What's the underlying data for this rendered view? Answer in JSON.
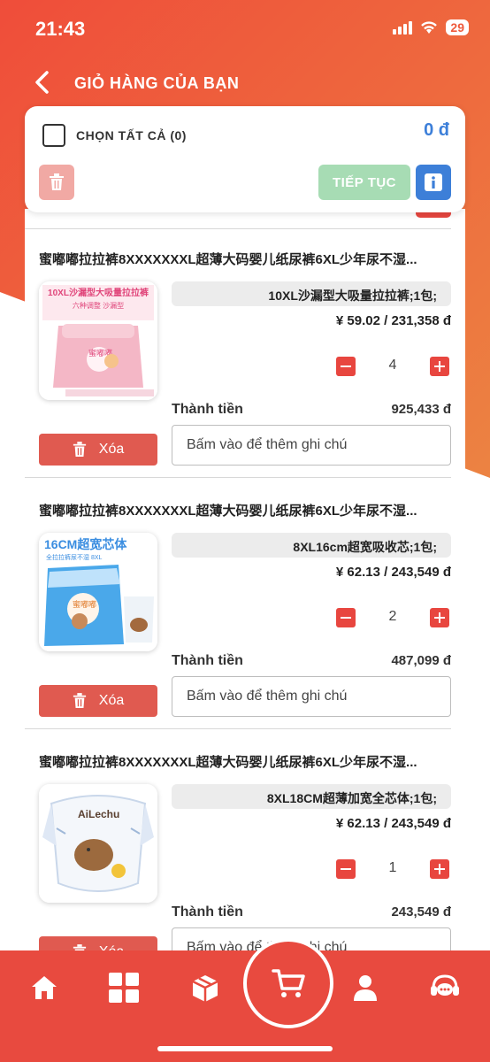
{
  "status_bar": {
    "time": "21:43",
    "battery": "29"
  },
  "header": {
    "title": "GIỎ HÀNG CỦA BẠN"
  },
  "top_card": {
    "select_all_label": "CHỌN TẤT CẢ (0)",
    "total": "0 đ",
    "continue_label": "TIẾP TỤC"
  },
  "items": [
    {
      "title": "蜜嘟嘟拉拉裤8XXXXXXXL超薄大码婴儿纸尿裤6XL少年尿不湿...",
      "variant": "10XL沙漏型大吸量拉拉裤;1包;",
      "price": "¥ 59.02 / 231,358 đ",
      "quantity": "4",
      "subtotal_label": "Thành tiền",
      "subtotal": "925,433 đ",
      "delete_label": "Xóa",
      "note_placeholder": "Bấm vào để thêm ghi chú",
      "thumb_banner": "10XL沙漏型大吸量拉拉裤",
      "thumb_brand": "蜜嘟嘟"
    },
    {
      "title": "蜜嘟嘟拉拉裤8XXXXXXXL超薄大码婴儿纸尿裤6XL少年尿不湿...",
      "variant": "8XL16cm超宽吸收芯;1包;",
      "price": "¥ 62.13 / 243,549 đ",
      "quantity": "2",
      "subtotal_label": "Thành tiền",
      "subtotal": "487,099 đ",
      "delete_label": "Xóa",
      "note_placeholder": "Bấm vào để thêm ghi chú",
      "thumb_banner": "16CM超宽芯体",
      "thumb_brand": "蜜嘟嘟"
    },
    {
      "title": "蜜嘟嘟拉拉裤8XXXXXXXL超薄大码婴儿纸尿裤6XL少年尿不湿...",
      "variant": "8XL18CM超薄加宽全芯体;1包;",
      "price": "¥ 62.13 / 243,549 đ",
      "quantity": "1",
      "subtotal_label": "Thành tiền",
      "subtotal": "243,549 đ",
      "delete_label": "Xóa",
      "note_placeholder": "Bấm vào để thêm ghi chú",
      "thumb_banner": "",
      "thumb_brand": "AiLechu"
    }
  ],
  "nav": {
    "icons": [
      "home-icon",
      "grid-icon",
      "box-icon",
      "cart-icon",
      "user-icon",
      "support-icon"
    ]
  },
  "colors": {
    "accent": "#e84a3f",
    "blue": "#3d7fd8",
    "green": "#a7dcb4"
  }
}
